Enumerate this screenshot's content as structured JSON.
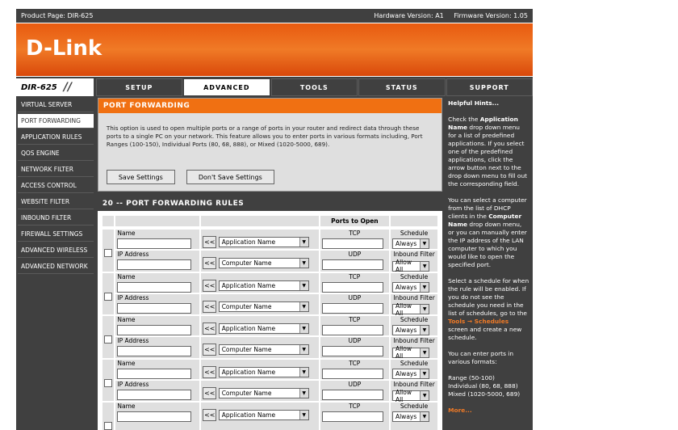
{
  "topbar": {
    "product_page": "Product Page: DIR-625",
    "hardware": "Hardware Version: A1",
    "firmware": "Firmware Version: 1.05"
  },
  "brand": {
    "logo": "D-Link",
    "model": "DIR-625",
    "accent": "#f07012"
  },
  "nav_tabs": [
    "SETUP",
    "ADVANCED",
    "TOOLS",
    "STATUS",
    "SUPPORT"
  ],
  "sidebar": [
    "VIRTUAL SERVER",
    "PORT FORWARDING",
    "APPLICATION RULES",
    "QOS ENGINE",
    "NETWORK FILTER",
    "ACCESS CONTROL",
    "WEBSITE FILTER",
    "INBOUND FILTER",
    "FIREWALL SETTINGS",
    "ADVANCED WIRELESS",
    "ADVANCED NETWORK"
  ],
  "port_forwarding": {
    "title": "PORT FORWARDING",
    "description": "This option is used to open multiple ports or a range of ports in your router and redirect data through these ports to a single PC on your network. This feature allows you to enter ports in various formats including, Port Ranges (100-150), Individual Ports (80, 68, 888), or Mixed (1020-5000, 689).",
    "save_label": "Save Settings",
    "dont_save_label": "Don't Save Settings"
  },
  "rules": {
    "title": "20 -- PORT FORWARDING RULES",
    "ports_header": "Ports to Open",
    "name_label": "Name",
    "ip_label": "IP Address",
    "tcp_label": "TCP",
    "udp_label": "UDP",
    "schedule_label": "Schedule",
    "inbound_label": "Inbound Filter",
    "app_select": "Application Name",
    "computer_select": "Computer Name",
    "schedule_value": "Always",
    "inbound_value": "Allow All",
    "arrow_label": "<<",
    "partial_app_select": "Application Name"
  },
  "hints": {
    "title": "Helpful Hints...",
    "p1_a": "Check the ",
    "p1_b": "Application Name",
    "p1_c": " drop down menu for a list of predefined applications. If you select one of the predefined applications, click the arrow button next to the drop down menu to fill out the corresponding field.",
    "p2_a": "You can select a computer from the list of DHCP clients in the ",
    "p2_b": "Computer Name",
    "p2_c": " drop down menu, or you can manually enter the IP address of the LAN computer to which you would like to open the specified port.",
    "p3_a": "Select a schedule for when the rule will be enabled. If you do not see the schedule you need in the list of schedules, go to the ",
    "p3_link": "Tools → Schedules",
    "p3_c": " screen and create a new schedule.",
    "p4": "You can enter ports in various formats:",
    "p5_1": "Range (50-100)",
    "p5_2": "Individual (80, 68, 888)",
    "p5_3": "Mixed (1020-5000, 689)",
    "more": "More..."
  }
}
